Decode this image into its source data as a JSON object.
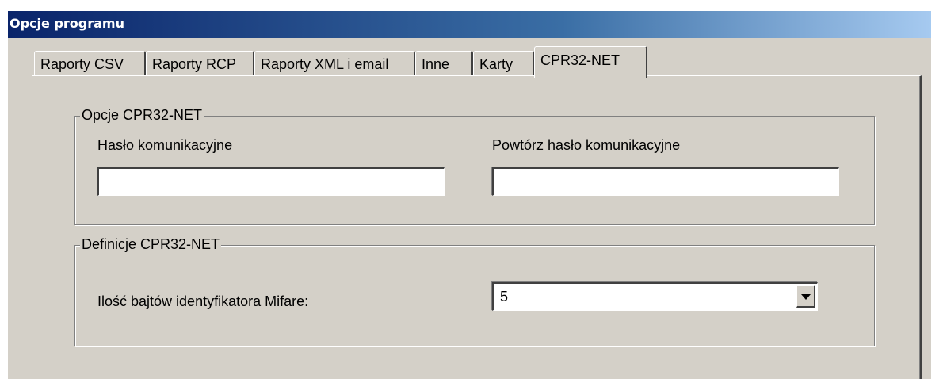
{
  "window": {
    "title": "Opcje programu"
  },
  "tabs": [
    {
      "label": "Raporty CSV",
      "active": false
    },
    {
      "label": "Raporty RCP",
      "active": false
    },
    {
      "label": "Raporty XML i email",
      "active": false
    },
    {
      "label": "Inne",
      "active": false
    },
    {
      "label": "Karty",
      "active": false
    },
    {
      "label": "CPR32-NET",
      "active": true
    }
  ],
  "options_group": {
    "legend": "Opcje CPR32-NET",
    "password_label": "Hasło komunikacyjne",
    "password_value": "",
    "repeat_password_label": "Powtórz hasło komunikacyjne",
    "repeat_password_value": ""
  },
  "definitions_group": {
    "legend": "Definicje CPR32-NET",
    "mifare_label": "Ilość bajtów identyfikatora Mifare:",
    "mifare_value": "5",
    "dropdown_icon": "chevron-down-icon"
  },
  "colors": {
    "titlebar_start": "#0a246a",
    "titlebar_end": "#a6caf0",
    "dialog_face": "#d4d0c8"
  }
}
